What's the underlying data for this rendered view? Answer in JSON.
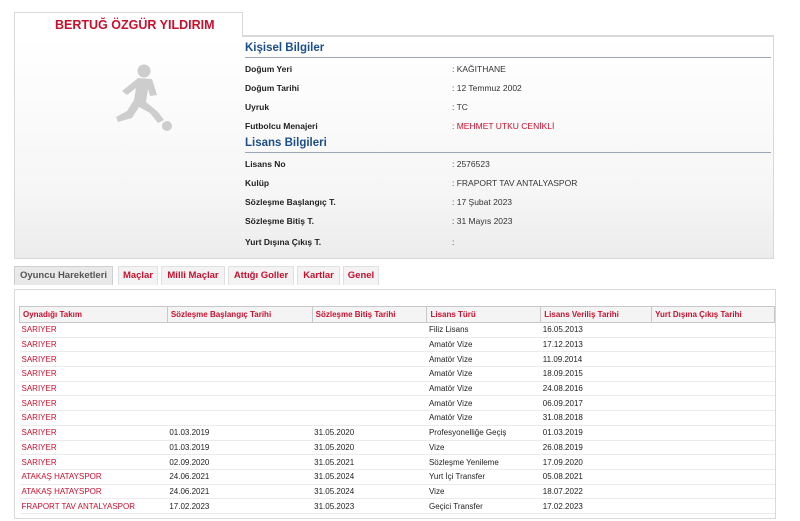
{
  "player": {
    "name": "BERTUĞ ÖZGÜR YILDIRIM"
  },
  "personal": {
    "title": "Kişisel Bilgiler",
    "rows": [
      {
        "label": "Doğum Yeri",
        "value": ": KAĞITHANE"
      },
      {
        "label": "Doğum Tarihi",
        "value": ": 12 Temmuz 2002"
      },
      {
        "label": "Uyruk",
        "value": ": TC"
      },
      {
        "label": "Futbolcu Menajeri",
        "value": ": MEHMET UTKU CENİKLİ"
      }
    ]
  },
  "license": {
    "title": "Lisans Bilgileri",
    "rows": [
      {
        "label": "Lisans No",
        "value": ": 2576523"
      },
      {
        "label": "Kulüp",
        "value": ": FRAPORT TAV ANTALYASPOR"
      },
      {
        "label": "Sözleşme Başlangıç T.",
        "value": ": 17 Şubat 2023"
      },
      {
        "label": "Sözleşme Bitiş T.",
        "value": ": 31 Mayıs 2023"
      },
      {
        "label": "Yurt Dışına Çıkış T.",
        "value": ":"
      }
    ]
  },
  "tabs": [
    "Oyuncu Hareketleri",
    "Maçlar",
    "Milli Maçlar",
    "Attığı Goller",
    "Kartlar",
    "Genel"
  ],
  "table": {
    "headers": [
      "Oynadığı Takım",
      "Sözleşme Başlangıç Tarihi",
      "Sözleşme Bitiş Tarihi",
      "Lisans Türü",
      "Lisans Veriliş Tarihi",
      "Yurt Dışına Çıkış Tarihi"
    ],
    "rows": [
      [
        "SARIYER",
        "",
        "",
        "Filiz Lisans",
        "16.05.2013",
        ""
      ],
      [
        "SARIYER",
        "",
        "",
        "Amatör Vize",
        "17.12.2013",
        ""
      ],
      [
        "SARIYER",
        "",
        "",
        "Amatör Vize",
        "11.09.2014",
        ""
      ],
      [
        "SARIYER",
        "",
        "",
        "Amatör Vize",
        "18.09.2015",
        ""
      ],
      [
        "SARIYER",
        "",
        "",
        "Amatör Vize",
        "24.08.2016",
        ""
      ],
      [
        "SARIYER",
        "",
        "",
        "Amatör Vize",
        "06.09.2017",
        ""
      ],
      [
        "SARIYER",
        "",
        "",
        "Amatör Vize",
        "31.08.2018",
        ""
      ],
      [
        "SARIYER",
        "01.03.2019",
        "31.05.2020",
        "Profesyonelliğe Geçiş",
        "01.03.2019",
        ""
      ],
      [
        "SARIYER",
        "01.03.2019",
        "31.05.2020",
        "Vize",
        "26.08.2019",
        ""
      ],
      [
        "SARIYER",
        "02.09.2020",
        "31.05.2021",
        "Sözleşme Yenileme",
        "17.09.2020",
        ""
      ],
      [
        "ATAKAŞ HATAYSPOR",
        "24.06.2021",
        "31.05.2024",
        "Yurt İçi Transfer",
        "05.08.2021",
        ""
      ],
      [
        "ATAKAŞ HATAYSPOR",
        "24.06.2021",
        "31.05.2024",
        "Vize",
        "18.07.2022",
        ""
      ],
      [
        "FRAPORT TAV ANTALYASPOR",
        "17.02.2023",
        "31.05.2023",
        "Geçici Transfer",
        "17.02.2023",
        ""
      ]
    ]
  },
  "colors": {
    "accent": "#c8102e",
    "section_title": "#1c4e8a"
  },
  "icons": {
    "photo_placeholder": "football-player-silhouette-icon"
  }
}
